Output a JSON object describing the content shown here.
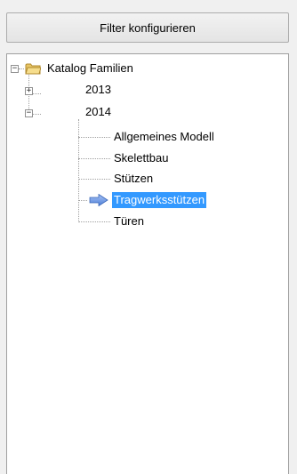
{
  "toolbar": {
    "filter_button_label": "Filter konfigurieren"
  },
  "tree": {
    "root": {
      "label": "Katalog Familien",
      "expanded": true,
      "icon": "folder-icon"
    },
    "years": [
      {
        "label": "2013",
        "expanded": false
      },
      {
        "label": "2014",
        "expanded": true
      }
    ],
    "items_2014": [
      {
        "label": "Allgemeines Modell"
      },
      {
        "label": "Skelettbau"
      },
      {
        "label": "Stützen"
      },
      {
        "label": "Tragwerksstützen",
        "selected": true,
        "icon": "arrow-right-icon"
      },
      {
        "label": "Türen"
      }
    ],
    "selection_color": "#3399ff"
  }
}
